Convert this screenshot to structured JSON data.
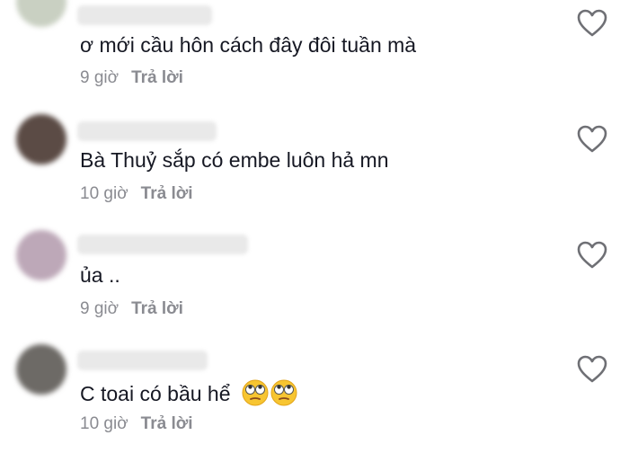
{
  "comments": [
    {
      "text": "ơ mới cầu hôn cách đây đôi tuần mà",
      "time": "9 giờ",
      "reply": "Trả lời",
      "avatar_color": "#c9d0c2"
    },
    {
      "text": "Bà Thuỷ sắp có embe luôn hả mn",
      "time": "10 giờ",
      "reply": "Trả lời",
      "avatar_color": "#5b4b45"
    },
    {
      "text": "ủa ..",
      "time": "9 giờ",
      "reply": "Trả lời",
      "avatar_color": "#bda8b8"
    },
    {
      "text": "C toai có bầu hể",
      "time": "10 giờ",
      "reply": "Trả lời",
      "avatar_color": "#6d6a66",
      "emojis": [
        "face-with-rolling-eyes-icon",
        "face-with-rolling-eyes-icon"
      ]
    }
  ]
}
